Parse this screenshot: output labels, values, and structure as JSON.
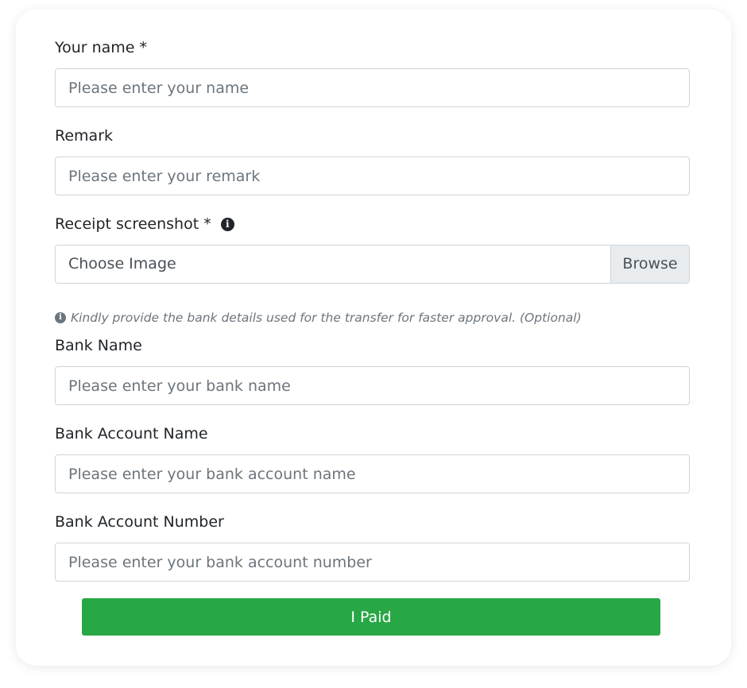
{
  "form": {
    "name": {
      "label": "Your name *",
      "placeholder": "Please enter your name"
    },
    "remark": {
      "label": "Remark",
      "placeholder": "Please enter your remark"
    },
    "receipt": {
      "label": "Receipt screenshot *",
      "info_icon": "info-circle-icon",
      "file_placeholder": "Choose Image",
      "browse_label": "Browse"
    },
    "hint": {
      "icon": "info-circle-icon",
      "text": "Kindly provide the bank details used for the transfer for faster approval. (Optional)"
    },
    "bank_name": {
      "label": "Bank Name",
      "placeholder": "Please enter your bank name"
    },
    "bank_account_name": {
      "label": "Bank Account Name",
      "placeholder": "Please enter your bank account name"
    },
    "bank_account_number": {
      "label": "Bank Account Number",
      "placeholder": "Please enter your bank account number"
    },
    "submit_label": "I Paid"
  },
  "colors": {
    "submit_bg": "#28a745",
    "browse_bg": "#e9ecef",
    "input_border": "#ced4da",
    "placeholder": "#6c757d"
  }
}
